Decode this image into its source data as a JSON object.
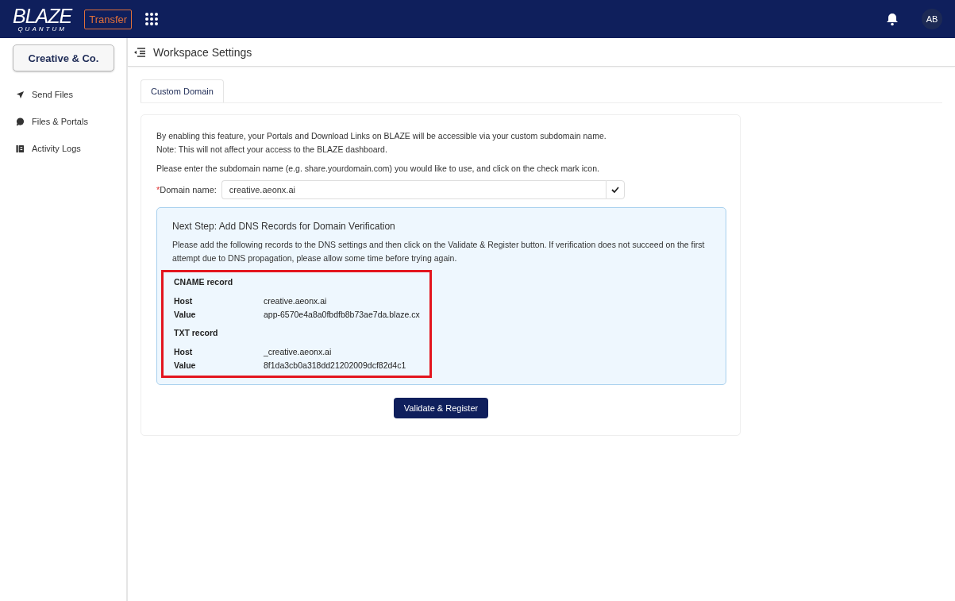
{
  "header": {
    "logo_main": "BLAZE",
    "logo_sub": "QUANTUM",
    "product_button": "Transfer",
    "avatar_initials": "AB"
  },
  "sidebar": {
    "workspace_button": "Creative & Co.",
    "items": [
      {
        "label": "Send Files"
      },
      {
        "label": "Files & Portals"
      },
      {
        "label": "Activity Logs"
      }
    ]
  },
  "page": {
    "title": "Workspace Settings"
  },
  "tabs": [
    {
      "label": "Custom Domain",
      "selected": true
    }
  ],
  "intro": [
    "By enabling this feature, your Portals and Download Links on BLAZE will be accessible via your custom subdomain name.",
    "Note: This will not affect your access to the BLAZE dashboard."
  ],
  "instruction": "Please enter the subdomain name (e.g. share.yourdomain.com) you would like to use, and click on the check mark icon.",
  "domain_field": {
    "label": "Domain name:",
    "required_mark": "*",
    "value": "creative.aeonx.ai"
  },
  "dns_panel": {
    "title": "Next Step: Add DNS Records for Domain Verification",
    "description": "Please add the following records to the DNS settings and then click on the Validate & Register button. If verification does not succeed on the first attempt due to DNS propagation, please allow some time before trying again.",
    "highlighted": true,
    "records": [
      {
        "title": "CNAME record",
        "rows": [
          {
            "label": "Host",
            "value": "creative.aeonx.ai"
          },
          {
            "label": "Value",
            "value": "app-6570e4a8a0fbdfb8b73ae7da.blaze.cx"
          }
        ]
      },
      {
        "title": "TXT record",
        "rows": [
          {
            "label": "Host",
            "value": "_creative.aeonx.ai"
          },
          {
            "label": "Value",
            "value": "8f1da3cb0a318dd21202009dcf82d4c1"
          }
        ]
      }
    ]
  },
  "submit_button": "Validate & Register"
}
